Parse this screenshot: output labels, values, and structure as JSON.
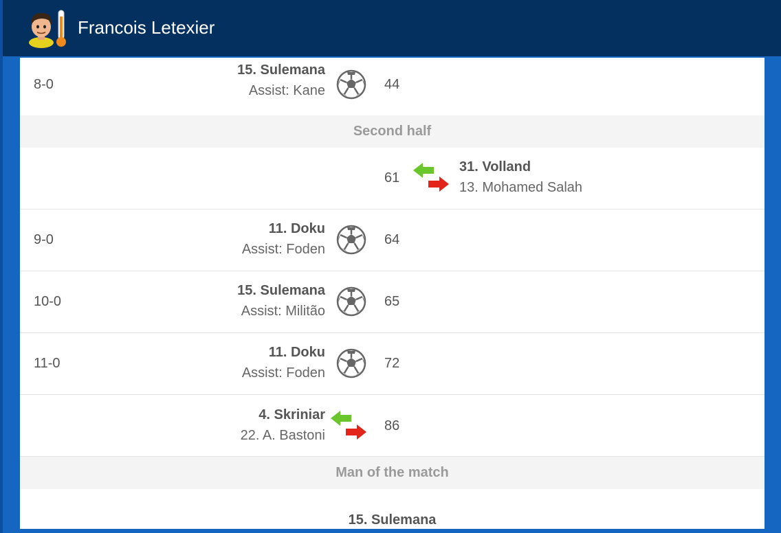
{
  "header": {
    "title": "Francois Letexier"
  },
  "events": [
    {
      "score": "8-0",
      "player": "15. Sulemana",
      "detail": "Assist: Kane",
      "minute": "44"
    },
    {
      "minute": "61",
      "player": "31. Volland",
      "detail": "13. Mohamed Salah"
    },
    {
      "score": "9-0",
      "player": "11. Doku",
      "detail": "Assist: Foden",
      "minute": "64"
    },
    {
      "score": "10-0",
      "player": "15. Sulemana",
      "detail": "Assist: Militão",
      "minute": "65"
    },
    {
      "score": "11-0",
      "player": "11. Doku",
      "detail": "Assist: Foden",
      "minute": "72"
    },
    {
      "player": "4. Skriniar",
      "detail": "22. A. Bastoni",
      "minute": "86"
    }
  ],
  "sections": {
    "second_half": "Second half",
    "man_of_the_match": "Man of the match"
  },
  "motm": {
    "player": "15. Sulemana"
  },
  "colors": {
    "header": "#03305f",
    "frame": "#1566c0",
    "sub_in": "#6ac62b",
    "sub_out": "#e2241a"
  },
  "icons": [
    "referee-avatar-icon",
    "thermometer-icon",
    "soccer-ball-icon",
    "substitution-icon"
  ]
}
